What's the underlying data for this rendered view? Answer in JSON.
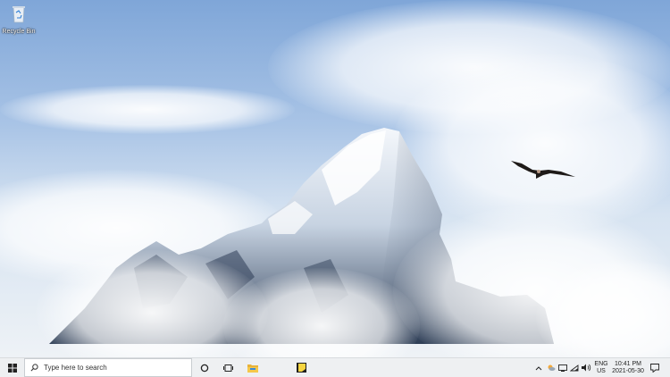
{
  "desktop": {
    "icons": [
      {
        "label": "Recycle Bin",
        "icon": "recycle-bin-icon"
      }
    ]
  },
  "taskbar": {
    "search_placeholder": "Type here to search",
    "pinned": [
      "cortana-icon",
      "task-view-icon",
      "file-explorer-icon",
      "sticky-notes-icon"
    ],
    "language": {
      "line1": "ENG",
      "line2": "US"
    },
    "clock": {
      "time": "10:41 PM",
      "date": "2021-05-30"
    },
    "tray_icons": [
      "show-hidden-icons",
      "weather-icon",
      "network-icon",
      "wifi-icon",
      "volume-icon"
    ]
  },
  "colors": {
    "taskbar_bg": "#eef0f2",
    "sky": "#7fa6d8"
  }
}
